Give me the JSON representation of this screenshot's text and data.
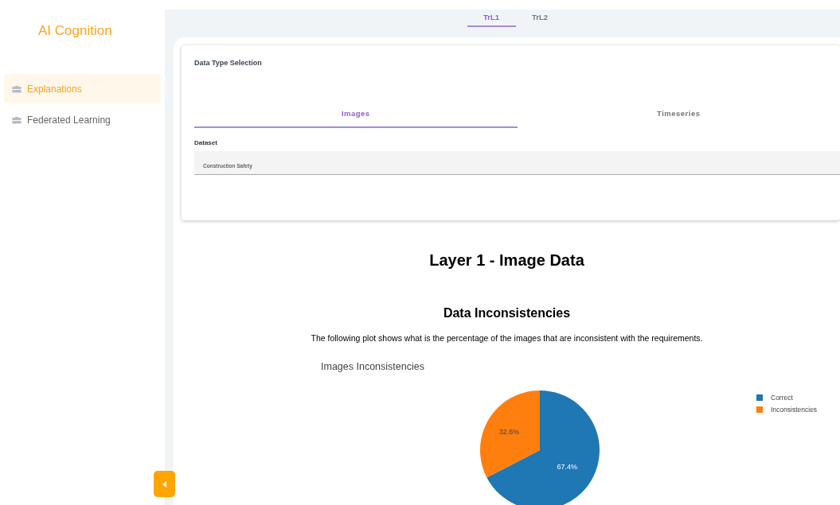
{
  "sidebar": {
    "logo": "AI Cognition",
    "items": [
      {
        "label": "Explanations",
        "selected": true
      },
      {
        "label": "Federated Learning",
        "selected": false
      }
    ]
  },
  "top_tabs": [
    {
      "label": "TrL1",
      "selected": true
    },
    {
      "label": "TrL2",
      "selected": false
    }
  ],
  "selection_card": {
    "title": "Data Type Selection",
    "tabs": [
      {
        "label": "Images",
        "selected": true
      },
      {
        "label": "Timeseries",
        "selected": false
      }
    ],
    "dataset": {
      "label": "Dataset",
      "value": "Construction Safety"
    }
  },
  "heading": "Layer 1 - Image Data",
  "section": {
    "title": "Data Inconsistencies",
    "description": "The following plot shows what is the percentage of the images that are inconsistent with the requirements.",
    "chart_data": {
      "type": "pie",
      "title": "Images Inconsistencies",
      "categories": [
        "Correct",
        "Inconsistencies"
      ],
      "values": [
        67.4,
        32.6
      ],
      "data_labels": true,
      "value_labels": [
        "67.4%",
        "32.6%"
      ],
      "colors": [
        "#1f77b4",
        "#ff7f0e"
      ],
      "legend": true
    }
  }
}
